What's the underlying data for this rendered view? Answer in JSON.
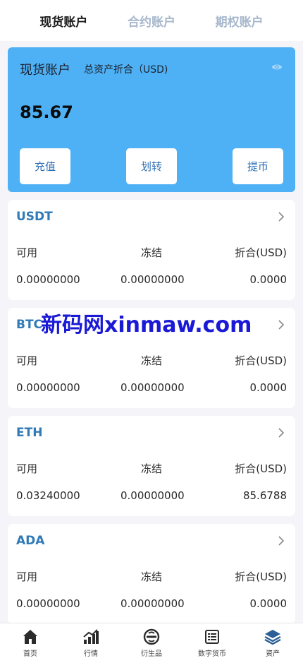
{
  "tabs": [
    "现货账户",
    "合约账户",
    "期权账户"
  ],
  "summary": {
    "title": "现货账户",
    "subtitle": "总资产折合（USD)",
    "total": "85.67",
    "buttons": [
      "充值",
      "划转",
      "提币"
    ]
  },
  "columns": [
    "可用",
    "冻结",
    "折合(USD)"
  ],
  "assets": [
    {
      "coin": "USDT",
      "available": "0.00000000",
      "frozen": "0.00000000",
      "usd": "0.0000"
    },
    {
      "coin": "BTC",
      "available": "0.00000000",
      "frozen": "0.00000000",
      "usd": "0.0000"
    },
    {
      "coin": "ETH",
      "available": "0.03240000",
      "frozen": "0.00000000",
      "usd": "85.6788"
    },
    {
      "coin": "ADA",
      "available": "0.00000000",
      "frozen": "0.00000000",
      "usd": "0.0000"
    }
  ],
  "watermark": "新码网xinmaw.com",
  "nav": [
    "首页",
    "行情",
    "衍生品",
    "数字货币",
    "资产"
  ],
  "colors": {
    "accent": "#4fb1f5",
    "coin": "#2f7ab7",
    "tab_inactive": "#a7b7cc"
  }
}
